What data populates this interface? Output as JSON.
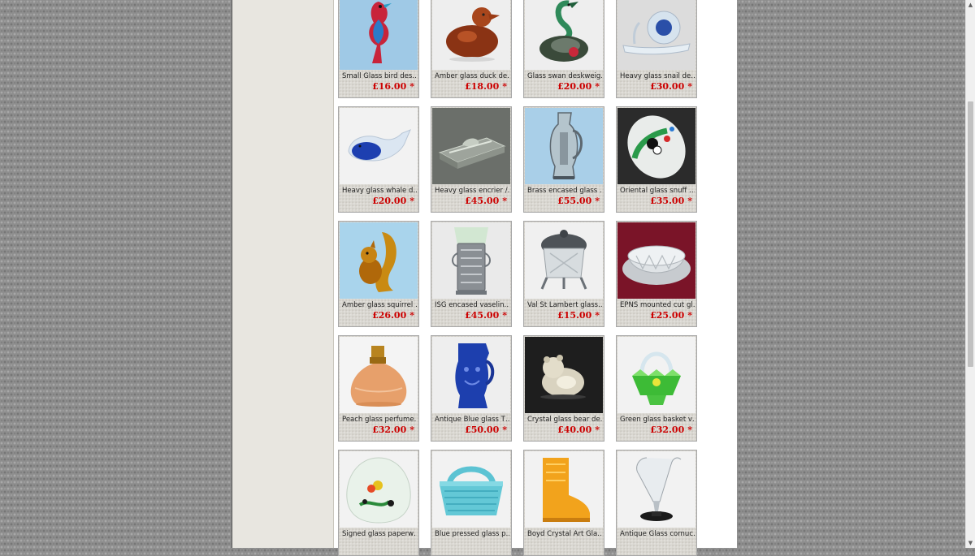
{
  "products": [
    {
      "name": "Small Glass bird des…",
      "price": "£16.00",
      "marker": "*",
      "icon": "glass-bird-icon",
      "photo": "#9fc9e6"
    },
    {
      "name": "Amber glass duck de…",
      "price": "£18.00",
      "marker": "*",
      "icon": "amber-duck-icon",
      "photo": "#eeeeee"
    },
    {
      "name": "Glass swan deskweig…",
      "price": "£20.00",
      "marker": "*",
      "icon": "glass-swan-icon",
      "photo": "#eeeeee"
    },
    {
      "name": "Heavy glass snail de…",
      "price": "£30.00",
      "marker": "*",
      "icon": "glass-snail-icon",
      "photo": "#dcdcdc"
    },
    {
      "name": "Heavy glass whale d…",
      "price": "£20.00",
      "marker": "*",
      "icon": "glass-whale-icon",
      "photo": "#f2f2f2"
    },
    {
      "name": "Heavy glass encrier /…",
      "price": "£45.00",
      "marker": "*",
      "icon": "glass-inkwell-icon",
      "photo": "#6b6f6a"
    },
    {
      "name": "Brass encased glass …",
      "price": "£55.00",
      "marker": "*",
      "icon": "glass-jug-icon",
      "photo": "#a9cfe8"
    },
    {
      "name": "Oriental glass snuff …",
      "price": "£35.00",
      "marker": "*",
      "icon": "snuff-bottle-icon",
      "photo": "#2b2b2b"
    },
    {
      "name": "Amber glass squirrel …",
      "price": "£26.00",
      "marker": "*",
      "icon": "glass-squirrel-icon",
      "photo": "#a9d4ec"
    },
    {
      "name": "ISG encased vaselin…",
      "price": "£45.00",
      "marker": "*",
      "icon": "vaseline-vase-icon",
      "photo": "#eaeaea"
    },
    {
      "name": "Val St Lambert glass…",
      "price": "£15.00",
      "marker": "*",
      "icon": "glass-pot-icon",
      "photo": "#f0f0f0"
    },
    {
      "name": "EPNS mounted cut gl…",
      "price": "£25.00",
      "marker": "*",
      "icon": "cut-glass-bowl-icon",
      "photo": "#7a1428"
    },
    {
      "name": "Peach glass perfume…",
      "price": "£32.00",
      "marker": "*",
      "icon": "perfume-bottle-icon",
      "photo": "#f4f4f4"
    },
    {
      "name": "Antique Blue glass T…",
      "price": "£50.00",
      "marker": "*",
      "icon": "blue-toby-jug-icon",
      "photo": "#eeeeee"
    },
    {
      "name": "Crystal glass bear de…",
      "price": "£40.00",
      "marker": "*",
      "icon": "crystal-bear-icon",
      "photo": "#1e1e1e"
    },
    {
      "name": "Green glass basket v…",
      "price": "£32.00",
      "marker": "*",
      "icon": "green-basket-icon",
      "photo": "#f2f2f2"
    },
    {
      "name": "Signed glass paperw…",
      "price": "",
      "marker": "",
      "icon": "glass-paperweight-icon",
      "photo": "#f2f2f2"
    },
    {
      "name": "Blue pressed glass p…",
      "price": "",
      "marker": "",
      "icon": "blue-basket-icon",
      "photo": "#f2f2f2"
    },
    {
      "name": "Boyd Crystal Art Gla…",
      "price": "",
      "marker": "",
      "icon": "glass-boot-icon",
      "photo": "#f2f2f2"
    },
    {
      "name": "Antique Glass cornuc…",
      "price": "",
      "marker": "",
      "icon": "glass-cornucopia-icon",
      "photo": "#f2f2f2"
    }
  ],
  "scrollbar": {
    "up_arrow": "▲",
    "down_arrow": "▼",
    "position": 0.35
  }
}
